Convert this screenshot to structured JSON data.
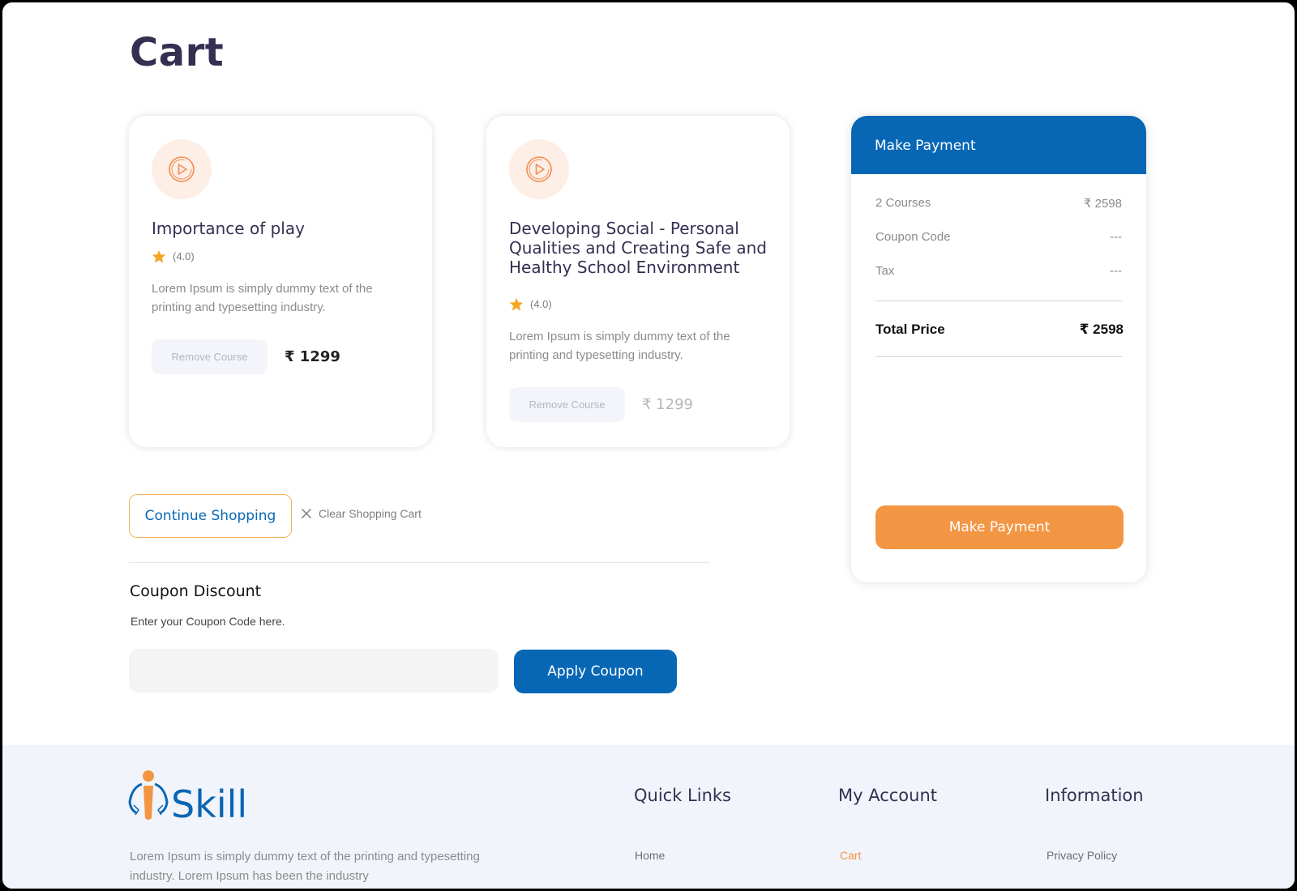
{
  "page": {
    "title": "Cart"
  },
  "courses": [
    {
      "title": "Importance of play",
      "rating": "(4.0)",
      "description": "Lorem Ipsum is simply dummy text of the printing and typesetting industry.",
      "remove_label": "Remove Course",
      "price": "₹ 1299"
    },
    {
      "title": "Developing Social - Personal Qualities and Creating Safe and Healthy School Environment",
      "rating": "(4.0)",
      "description": "Lorem Ipsum is simply dummy text of the printing and typesetting industry.",
      "remove_label": "Remove Course",
      "price": "₹ 1299"
    }
  ],
  "actions": {
    "continue_label": "Continue Shopping",
    "clear_label": "Clear Shopping Cart"
  },
  "coupon": {
    "title": "Coupon Discount",
    "subtitle": "Enter your Coupon Code here.",
    "input_value": "",
    "apply_label": "Apply Coupon"
  },
  "payment": {
    "header": "Make Payment",
    "courses_label": "2 Courses",
    "courses_value": "₹ 2598",
    "coupon_label": "Coupon Code",
    "coupon_value": "---",
    "tax_label": "Tax",
    "tax_value": "---",
    "total_label": "Total Price",
    "total_value": "₹ 2598",
    "button_label": "Make Payment"
  },
  "footer": {
    "logo_text": "Skill",
    "description": "Lorem Ipsum is simply dummy text of the printing and typesetting industry. Lorem Ipsum has been the industry",
    "quick_links_title": "Quick Links",
    "quick_links_first": "Home",
    "my_account_title": "My Account",
    "my_account_first": "Cart",
    "information_title": "Information",
    "information_first": "Privacy Policy"
  },
  "colors": {
    "primary_blue": "#0767b5",
    "accent_orange": "#f39643",
    "title_navy": "#352f52",
    "star": "#f5a623"
  },
  "icons": {
    "course_icon": "play-circle-icon",
    "rating_icon": "star-icon",
    "clear_icon": "close-icon"
  }
}
